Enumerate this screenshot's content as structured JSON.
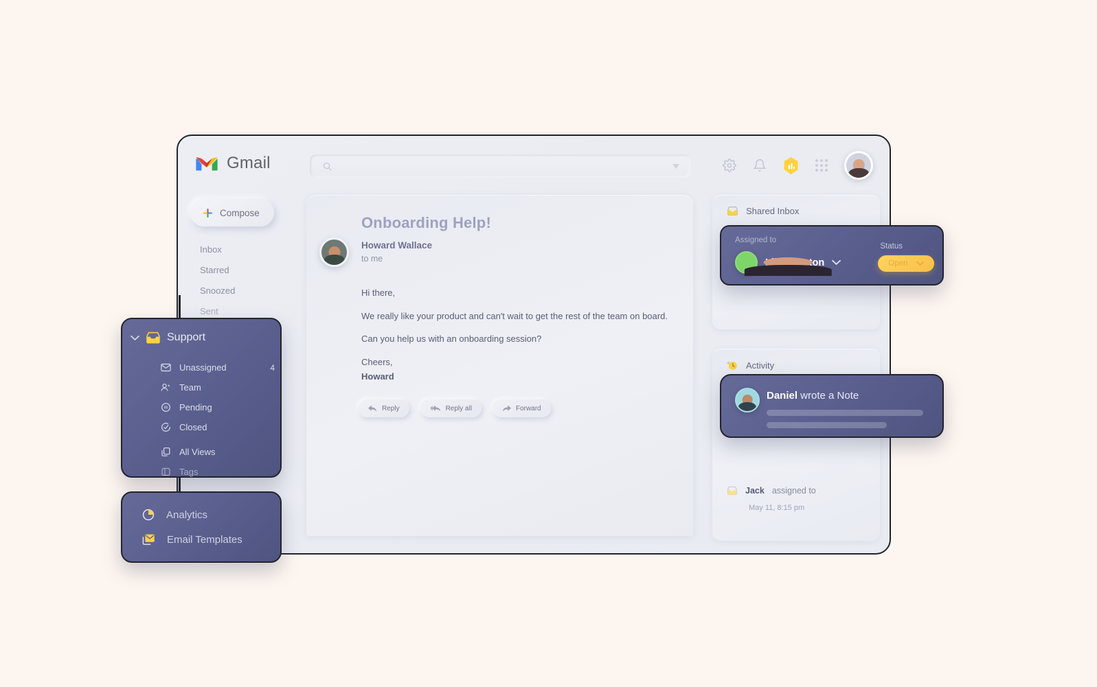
{
  "theme": {
    "page_bg": "#fdf6f0",
    "window_bg": "#eceef4",
    "dark_panel": "#5c6090",
    "accent_yellow": "#ffd45e",
    "subject_purple": "#9da2c0"
  },
  "header": {
    "brand": "Gmail",
    "logo_icon": "gmail-logo-icon",
    "search": {
      "value": "",
      "placeholder": "",
      "icon": "search-icon",
      "caret_icon": "chevron-down-icon"
    },
    "icons": [
      {
        "name": "gear-icon",
        "label": "Settings"
      },
      {
        "name": "bell-icon",
        "label": "Notifications"
      },
      {
        "name": "hexagon-chart-icon",
        "label": "Insights"
      },
      {
        "name": "apps-grid-icon",
        "label": "Google apps"
      },
      {
        "name": "user-avatar",
        "label": "Account"
      }
    ]
  },
  "sidebar": {
    "compose": {
      "label": "Compose",
      "icon": "plus-icon"
    },
    "items": [
      {
        "label": "Inbox"
      },
      {
        "label": "Starred"
      },
      {
        "label": "Snoozed"
      },
      {
        "label": "Sent"
      }
    ]
  },
  "support_panel": {
    "title": "Support",
    "chevron_icon": "chevron-down-icon",
    "inbox_icon": "inbox-icon",
    "items": [
      {
        "label": "Unassigned",
        "count": "4",
        "icon": "envelope-icon"
      },
      {
        "label": "Team",
        "count": "",
        "icon": "people-icon"
      },
      {
        "label": "Pending",
        "count": "",
        "icon": "pause-circle-icon"
      },
      {
        "label": "Closed",
        "count": "",
        "icon": "check-circle-icon"
      },
      {
        "label": "All Views",
        "count": "",
        "icon": "copy-icon"
      },
      {
        "label": "Tags",
        "count": "",
        "icon": "tag-panel-icon"
      }
    ]
  },
  "tools_panel": {
    "items": [
      {
        "label": "Analytics",
        "icon": "pie-chart-icon"
      },
      {
        "label": "Email Templates",
        "icon": "envelope-template-icon"
      }
    ]
  },
  "email": {
    "subject": "Onboarding Help!",
    "sender": "Howard Wallace",
    "recipient": "to me",
    "greeting": "Hi there,",
    "paragraph_1": "We really like your product and can't wait to get the rest of the team on board.",
    "paragraph_2": "Can you help us with an onboarding session?",
    "signoff": "Cheers,",
    "signature": "Howard",
    "actions": [
      {
        "label": "Reply",
        "icon": "reply-arrow-icon"
      },
      {
        "label": "Reply all",
        "icon": "reply-all-arrow-icon"
      },
      {
        "label": "Forward",
        "icon": "forward-arrow-icon"
      }
    ]
  },
  "shared_inbox": {
    "title": "Shared Inbox",
    "icon": "inbox-icon",
    "assigned_to_label": "Assigned to",
    "assignee": "Lilly Clayton",
    "assignee_caret_icon": "chevron-down-icon",
    "status_label": "Status",
    "status_value": "Open",
    "status_caret_icon": "chevron-down-icon"
  },
  "activity": {
    "title": "Activity",
    "icon": "history-clock-icon",
    "note": {
      "author": "Daniel",
      "action": " wrote a Note"
    },
    "entry": {
      "actor": "Jack",
      "action": "assigned to",
      "icon": "inbox-icon"
    },
    "timestamp": "May 11, 8:15 pm"
  }
}
